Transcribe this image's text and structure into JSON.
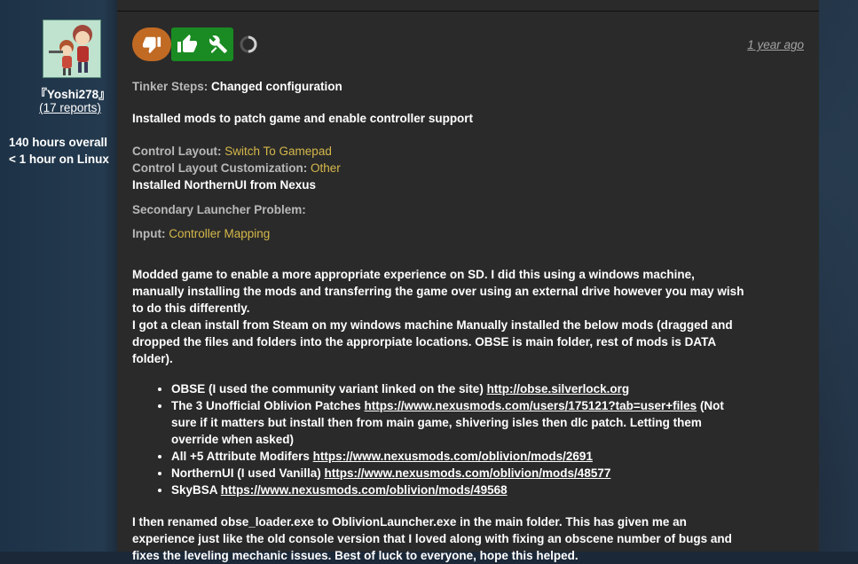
{
  "user": {
    "name": "『Yoshi278』",
    "reports": "(17 reports)",
    "hours_overall": "140 hours overall",
    "hours_linux": "< 1 hour on Linux"
  },
  "report": {
    "time_ago": "1 year ago",
    "tinker_steps_label": "Tinker Steps:",
    "tinker_steps_value": "Changed configuration",
    "installed_mods_line": "Installed mods to patch game and enable controller support",
    "control_layout_label": "Control Layout:",
    "control_layout_value": "Switch To Gamepad",
    "control_custom_label": "Control Layout Customization:",
    "control_custom_value": "Other",
    "northern_ui_line": "Installed NorthernUI from Nexus",
    "secondary_launcher_label": "Secondary Launcher Problem:",
    "input_label": "Input:",
    "input_value": "Controller Mapping",
    "para1": "Modded game to enable a more appropriate experience on SD. I did this using a windows machine, manually installing the mods and transferring the game over using an external drive however you may wish to do this differently.",
    "para2": "I got a clean install from Steam on my windows machine Manually installed the below mods (dragged and dropped the files and folders into the approrpiate locations. OBSE is main folder, rest of mods is DATA folder).",
    "mods": [
      {
        "text": "OBSE (I used the community variant linked on the site) ",
        "link": "http://obse.silverlock.org",
        "after": ""
      },
      {
        "text": "The 3 Unofficial Oblivion Patches ",
        "link": "https://www.nexusmods.com/users/175121?tab=user+files",
        "after": " (Not sure if it matters but install then from main game, shivering isles then dlc patch. Letting them override when asked)"
      },
      {
        "text": "All +5 Attribute Modifers ",
        "link": "https://www.nexusmods.com/oblivion/mods/2691",
        "after": ""
      },
      {
        "text": "NorthernUI (I used Vanilla) ",
        "link": "https://www.nexusmods.com/oblivion/mods/48577",
        "after": ""
      },
      {
        "text": "SkyBSA ",
        "link": "https://www.nexusmods.com/oblivion/mods/49568",
        "after": ""
      }
    ],
    "para3": "I then renamed obse_loader.exe to OblivionLauncher.exe in the main folder. This has given me an experience just like the old console version that I loved along with fixing an obscene number of bugs and fixes the leveling mechanic issues. Best of luck to everyone, hope this helped."
  },
  "icons": {
    "thumbs_down": "thumbs-down-icon",
    "thumbs_up": "thumbs-up-icon",
    "tools": "tools-icon",
    "loading": "loading-spinner-icon"
  },
  "colors": {
    "thumbs_down_bg": "#c06a24",
    "thumbs_up_bg": "#1a8b22",
    "value_text": "#d6b84a",
    "label_text": "#b8b8b8",
    "panel_bg": "#2a2a2a"
  }
}
